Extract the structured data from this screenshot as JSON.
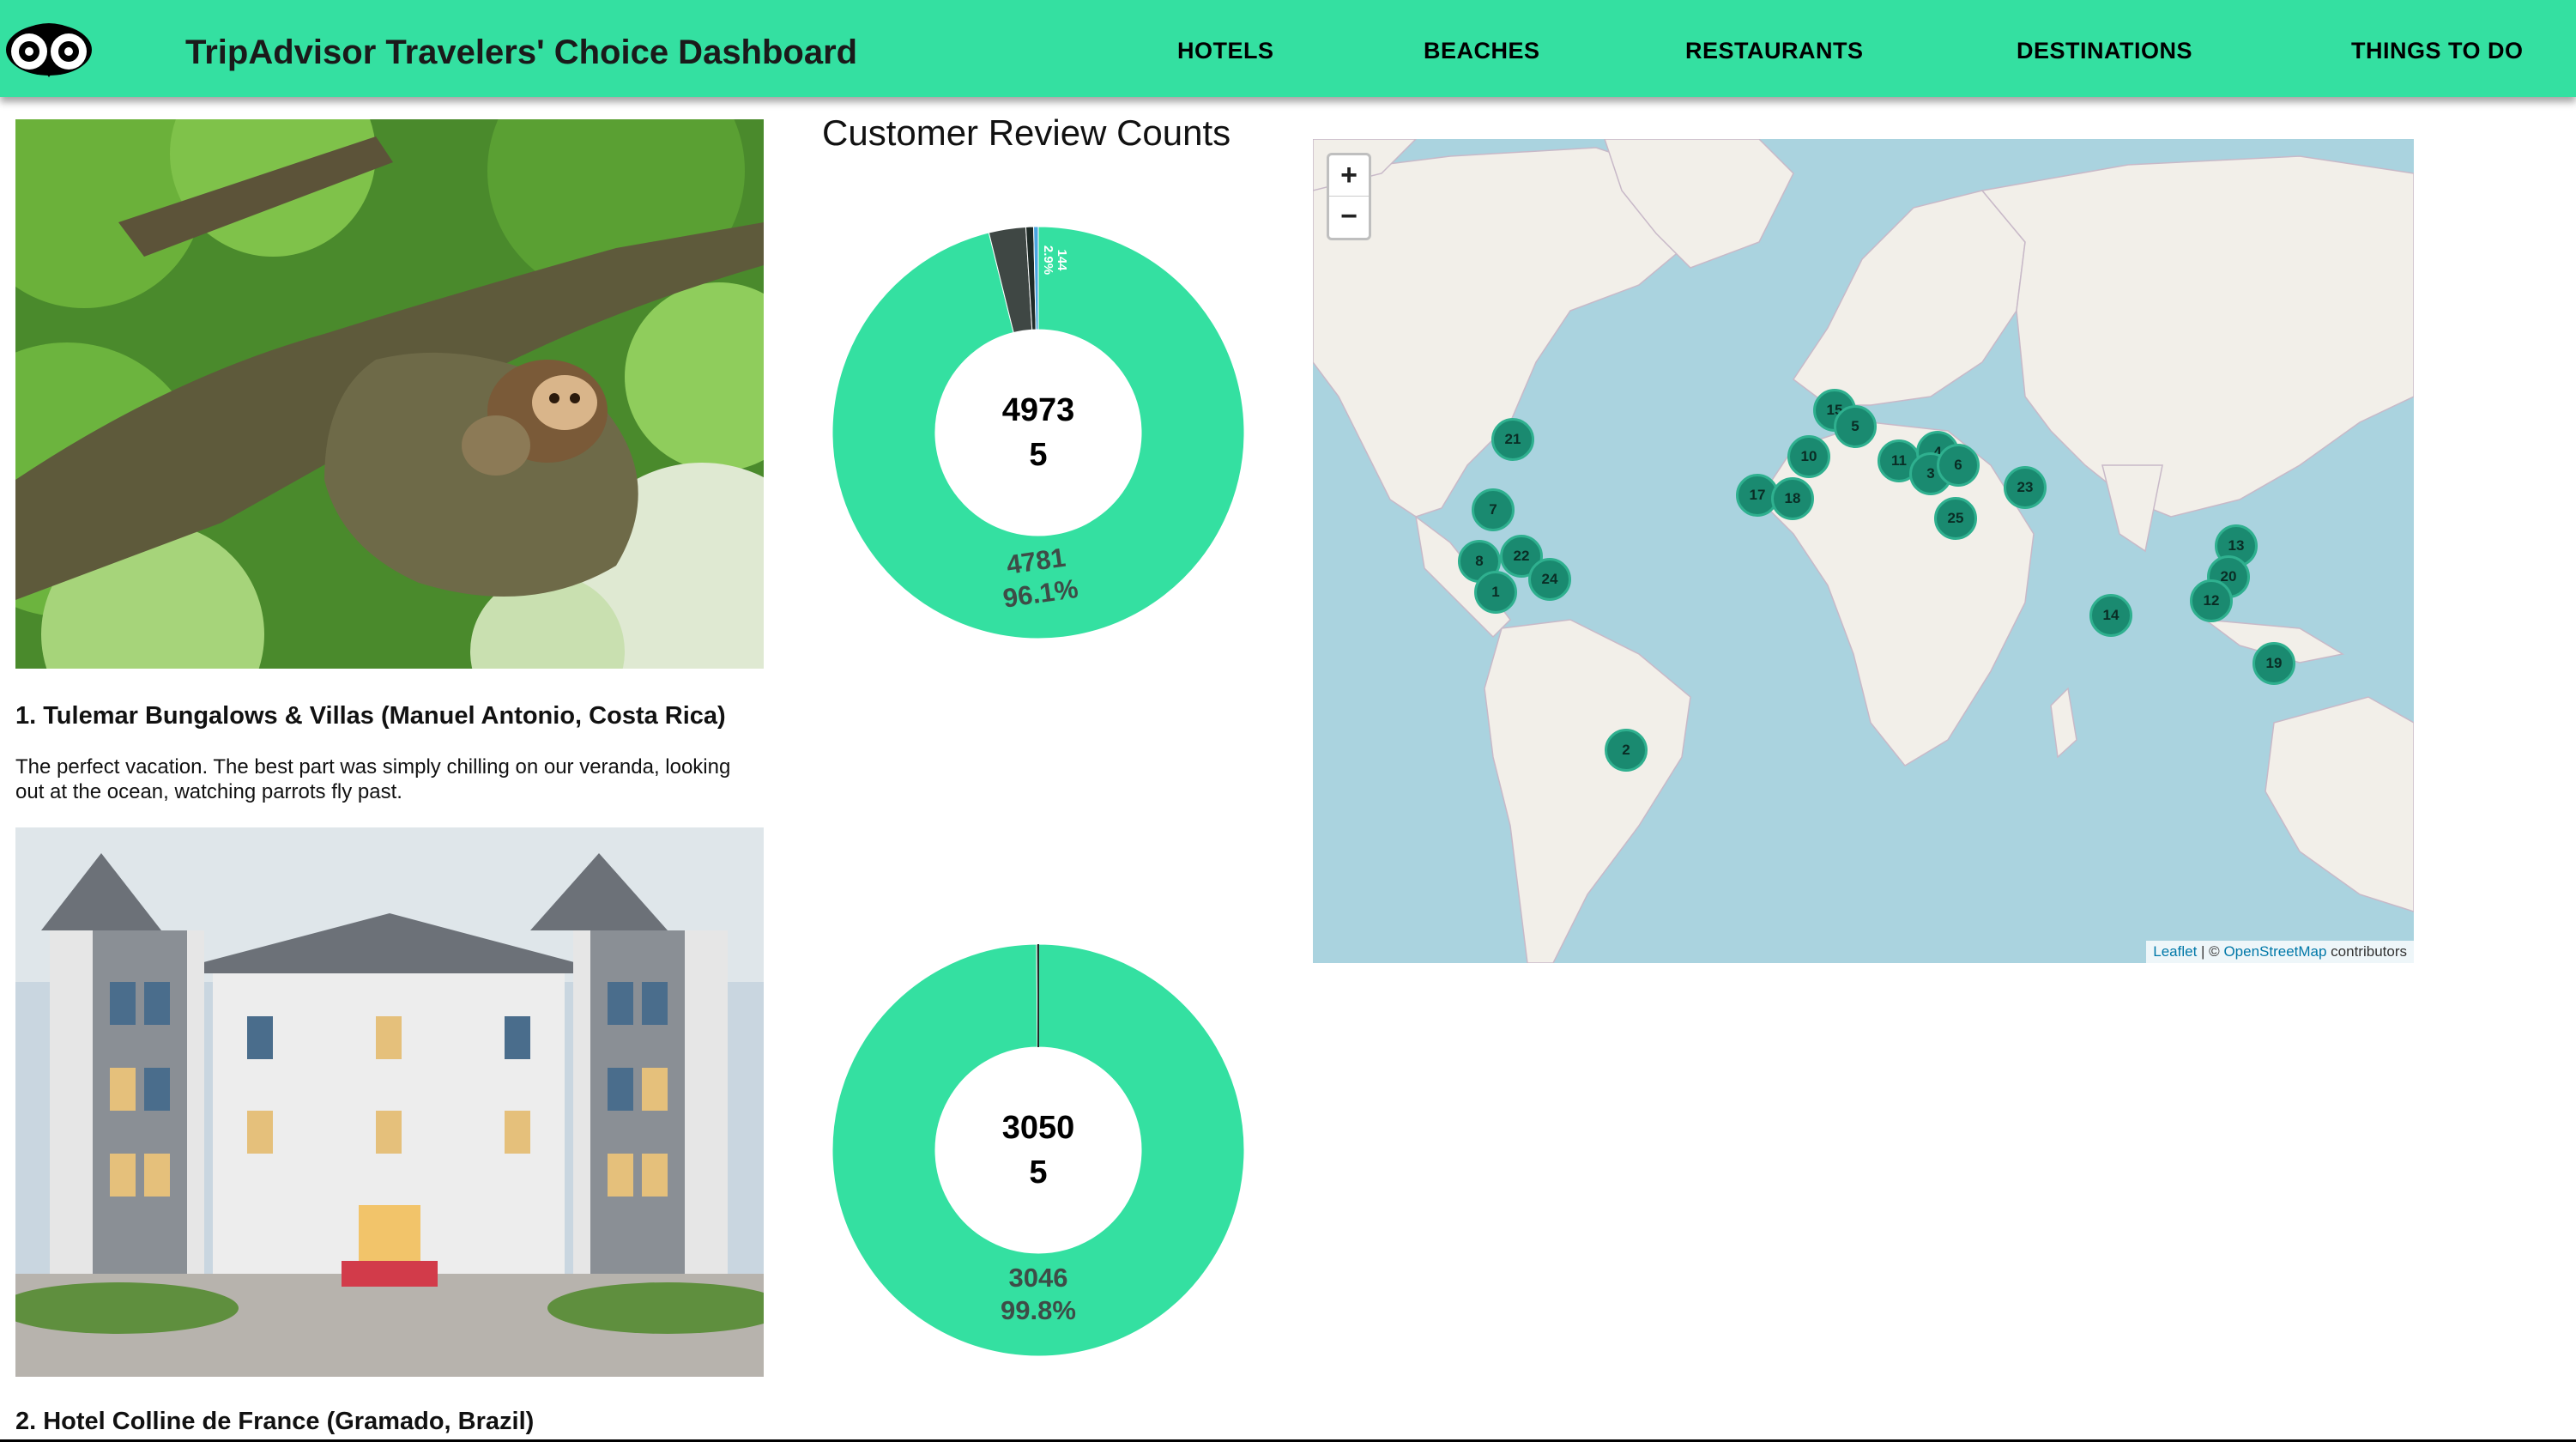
{
  "header": {
    "title": "TripAdvisor Travelers' Choice Dashboard",
    "nav": [
      "HOTELS",
      "BEACHES",
      "RESTAURANTS",
      "DESTINATIONS",
      "THINGS TO DO"
    ]
  },
  "hotels": [
    {
      "title": "1. Tulemar Bungalows & Villas (Manuel Antonio, Costa Rica)",
      "review": "The perfect vacation. The best part was simply chilling on our veranda, looking out at the ocean, watching parrots fly past.",
      "photo_subject": "sloth-in-tree"
    },
    {
      "title": "2. Hotel Colline de France (Gramado, Brazil)",
      "photo_subject": "chateau-hotel-facade"
    }
  ],
  "reviews": {
    "title": "Customer Review Counts",
    "colors": {
      "main": "#34e0a1",
      "dark": "#3f4744",
      "blue": "#4aa6e0"
    },
    "chart_data": [
      {
        "type": "pie",
        "center": [
          "4973",
          "5"
        ],
        "slices": [
          {
            "label": "4781",
            "pct": "96.1%",
            "value": 4781,
            "color": "#34e0a1"
          },
          {
            "label": "144",
            "pct": "2.9%",
            "value": 144,
            "color": "#3f4744"
          },
          {
            "value": 30,
            "color": "#1f2b27"
          },
          {
            "value": 18,
            "color": "#4aa6e0"
          }
        ]
      },
      {
        "type": "pie",
        "center": [
          "3050",
          "5"
        ],
        "slices": [
          {
            "label": "3046",
            "pct": "99.8%",
            "value": 3046,
            "color": "#34e0a1"
          },
          {
            "value": 4,
            "color": "#3f4744"
          }
        ]
      }
    ]
  },
  "map": {
    "zoom_in": "+",
    "zoom_out": "−",
    "attribution_leaflet": "Leaflet",
    "attribution_sep": " | © ",
    "attribution_osm": "OpenStreetMap",
    "attribution_tail": " contributors",
    "markers": [
      "21",
      "7",
      "8",
      "22",
      "1",
      "24",
      "2",
      "15",
      "5",
      "10",
      "17",
      "18",
      "11",
      "4",
      "3",
      "6",
      "25",
      "23",
      "14",
      "13",
      "20",
      "12",
      "19"
    ]
  }
}
